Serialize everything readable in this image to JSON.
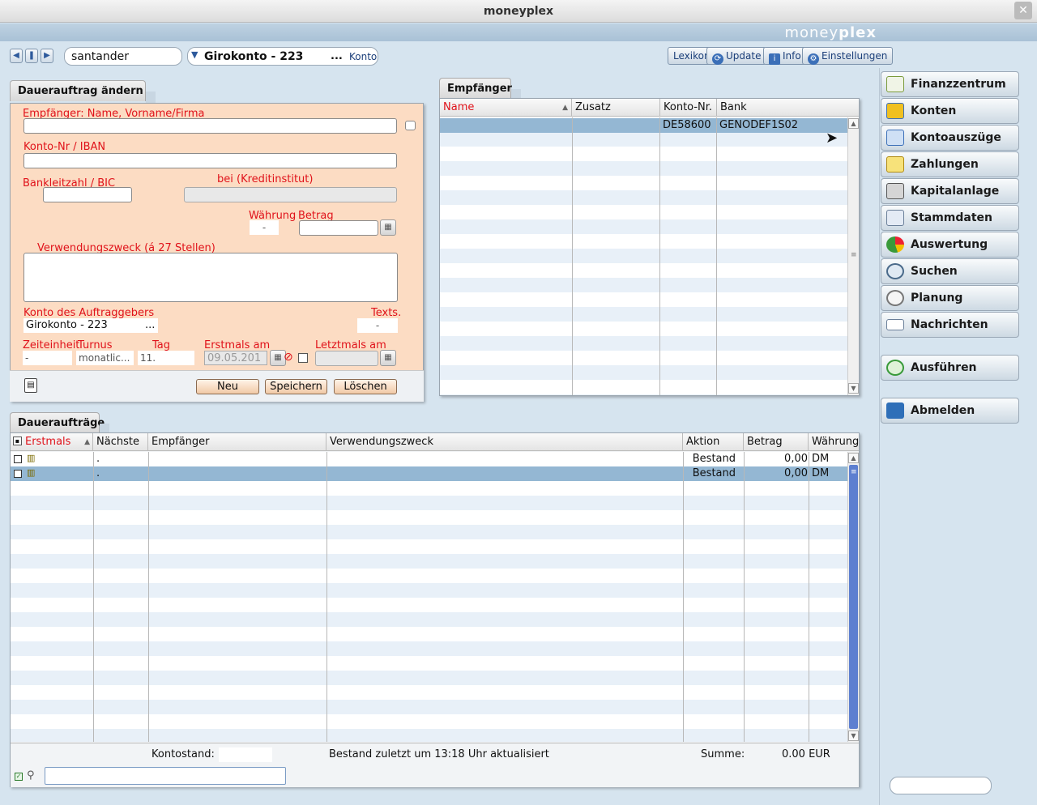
{
  "window": {
    "title": "moneyplex",
    "brand_light": "money",
    "brand_bold": "plex",
    "close_glyph": "✕"
  },
  "toolbar": {
    "search_value": "santander",
    "account_value": "Girokonto - 223",
    "account_ellipsis": "...",
    "account_link": "Konto",
    "buttons": {
      "lexikon": "Lexikon",
      "update": "Update",
      "info": "Info",
      "settings": "Einstellungen"
    }
  },
  "form": {
    "tab": "Dauerauftrag ändern",
    "label_name": "Empfänger: Name, Vorname/Firma",
    "label_iban": "Konto-Nr / IBAN",
    "label_blz": "Bankleitzahl / BIC",
    "label_bank": "bei (Kreditinstitut)",
    "label_currency": "Währung",
    "label_amount": "Betrag",
    "currency_value": "-",
    "label_purpose": "Verwendungszweck (á 27 Stellen)",
    "label_orderer": "Konto des Auftraggebers",
    "orderer_value": "Girokonto - 223",
    "orderer_ellipsis": "...",
    "label_texts": "Texts.",
    "texts_value": "-",
    "label_unit": "Zeiteinheit",
    "label_turnus": "Turnus",
    "label_day": "Tag",
    "label_first": "Erstmals am",
    "label_last": "Letztmals am",
    "unit_value": "-",
    "turnus_value": "monatlic...",
    "day_value": "11.",
    "first_value": "09.05.201",
    "btn_new": "Neu",
    "btn_save": "Speichern",
    "btn_delete": "Löschen"
  },
  "recipients": {
    "tab": "Empfänger",
    "columns": [
      "Name",
      "Zusatz",
      "Konto-Nr.",
      "Bank"
    ],
    "rows": [
      {
        "name": "",
        "extra": "",
        "account": "DE58600",
        "bank": "GENODEF1S02"
      }
    ]
  },
  "orders": {
    "tab": "Daueraufträge",
    "columns": [
      "Erstmals",
      "Nächste",
      "Empfänger",
      "Verwendungszweck",
      "Aktion",
      "Betrag",
      "Währung"
    ],
    "rows": [
      {
        "first": "",
        "next": ".",
        "recipient": "",
        "purpose": "",
        "action": "Bestand",
        "amount": "0,00",
        "currency": "DM"
      },
      {
        "first": "",
        "next": ".",
        "recipient": "",
        "purpose": "",
        "action": "Bestand",
        "amount": "0,00",
        "currency": "DM"
      }
    ],
    "footer_balance_label": "Kontostand:",
    "footer_status": "Bestand zuletzt um 13:18 Uhr aktualisiert",
    "footer_sum_label": "Summe:",
    "footer_sum_value": "0.00 EUR"
  },
  "sidebar": {
    "items": [
      "Finanzzentrum",
      "Konten",
      "Kontoauszüge",
      "Zahlungen",
      "Kapitalanlage",
      "Stammdaten",
      "Auswertung",
      "Suchen",
      "Planung",
      "Nachrichten"
    ],
    "execute": "Ausführen",
    "logout": "Abmelden"
  },
  "colors": {
    "accent": "#e0121a",
    "form_bg": "#fcdcc3",
    "selection": "#94b7d3"
  }
}
